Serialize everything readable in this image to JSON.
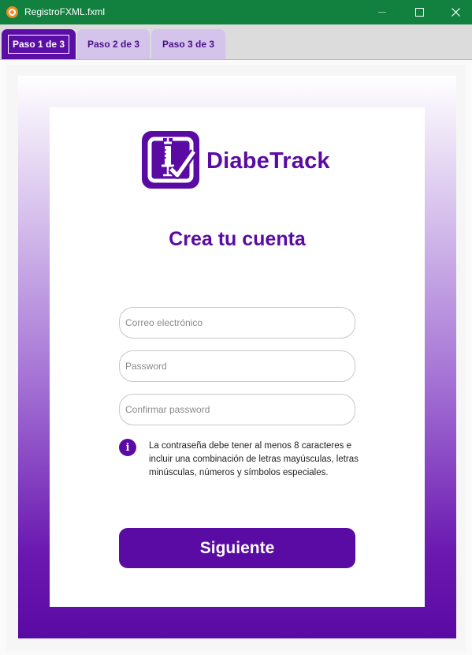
{
  "window": {
    "title": "RegistroFXML.fxml",
    "icons": {
      "app": "app-icon",
      "minimize": "minimize-icon",
      "maximize": "maximize-icon",
      "close": "close-icon"
    }
  },
  "tabs": [
    {
      "label": "Paso 1 de 3",
      "selected": true
    },
    {
      "label": "Paso 2 de 3",
      "selected": false
    },
    {
      "label": "Paso 3 de 3",
      "selected": false
    }
  ],
  "brand": {
    "name": "DiabeTrack",
    "logo_icon": "syringe-check-icon",
    "color": "#5a0ba3"
  },
  "form": {
    "heading": "Crea tu cuenta",
    "email_placeholder": "Correo electrónico",
    "email_value": "",
    "password_placeholder": "Password",
    "password_value": "",
    "confirm_placeholder": "Confirmar password",
    "confirm_value": "",
    "info_icon": "info-icon",
    "password_hint": "La contraseña debe tener al menos 8 caracteres e incluir una combinación de letras mayúsculas, letras minúsculas, números y símbolos especiales.",
    "next_label": "Siguiente"
  },
  "colors": {
    "titlebar": "#12813f",
    "accent": "#5a0ba3",
    "tab_inactive": "#d4c4ec"
  }
}
